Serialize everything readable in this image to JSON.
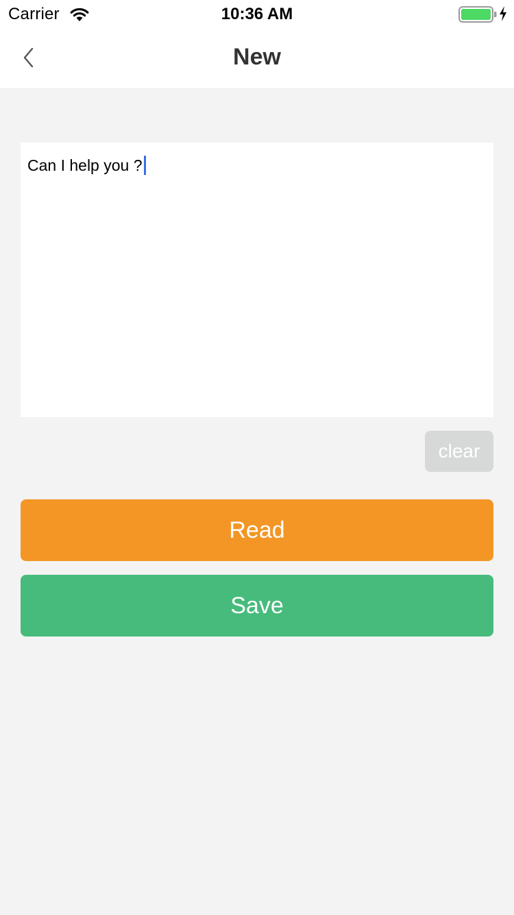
{
  "status_bar": {
    "carrier": "Carrier",
    "time": "10:36 AM",
    "battery_level": 1.0,
    "charging": true,
    "battery_color": "#4cd964"
  },
  "nav": {
    "title": "New",
    "back_icon": "chevron-left-icon"
  },
  "editor": {
    "value": "Can I help you ?"
  },
  "buttons": {
    "clear_label": "clear",
    "read_label": "Read",
    "save_label": "Save"
  },
  "colors": {
    "read": "#f39625",
    "save": "#47bb7c",
    "clear": "#d6d9d7",
    "caret": "#3a6ee8",
    "background": "#f3f3f3"
  }
}
